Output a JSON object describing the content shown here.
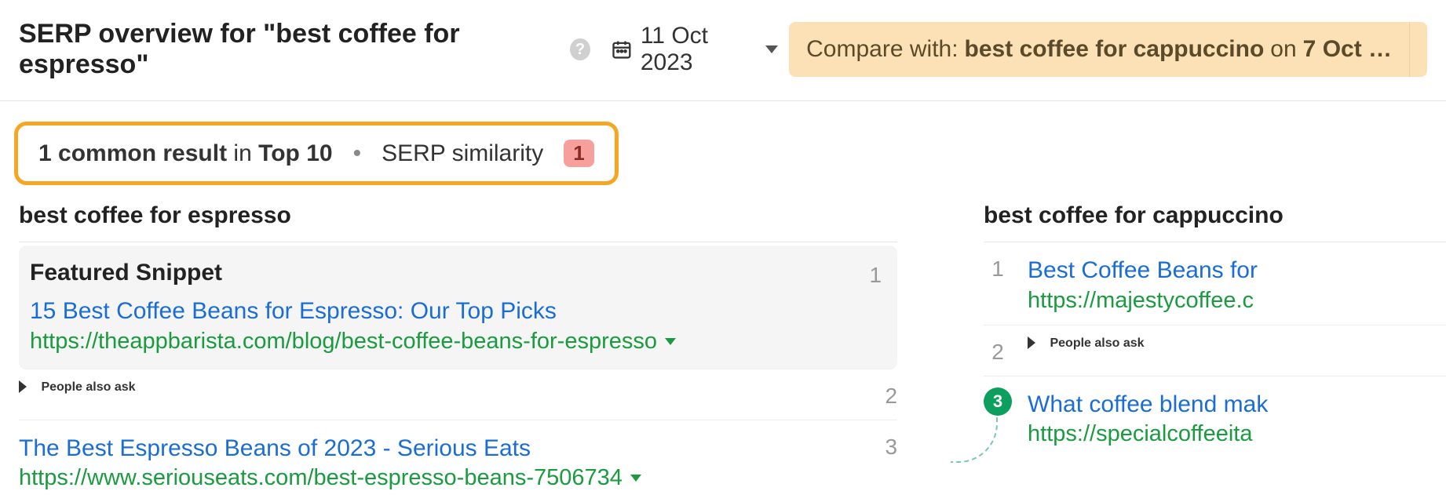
{
  "header": {
    "title_prefix": "SERP overview for \"",
    "keyword": "best coffee for espresso",
    "title_suffix": "\"",
    "date": "11 Oct 2023",
    "compare_prefix": "Compare with:",
    "compare_keyword": "best coffee for cappuccino",
    "compare_on": "on",
    "compare_date": "7 Oct …"
  },
  "stats": {
    "common_count": "1 common result",
    "common_in": "in",
    "common_scope": "Top 10",
    "similarity_label": "SERP similarity",
    "similarity_value": "1"
  },
  "left": {
    "heading": "best coffee for espresso",
    "featured_label": "Featured Snippet",
    "featured_rank": "1",
    "featured_title": "15 Best Coffee Beans for Espresso: Our Top Picks",
    "featured_url": "https://theappbarista.com/blog/best-coffee-beans-for-espresso",
    "paa_label": "People also ask",
    "paa_rank": "2",
    "r3_title": "The Best Espresso Beans of 2023 - Serious Eats",
    "r3_url": "https://www.seriouseats.com/best-espresso-beans-7506734",
    "r3_rank": "3"
  },
  "right": {
    "heading": "best coffee for cappuccino",
    "r1_rank": "1",
    "r1_title": "Best Coffee Beans for",
    "r1_url": "https://majestycoffee.c",
    "paa_rank": "2",
    "paa_label": "People also ask",
    "r3_rank": "3",
    "r3_title": "What coffee blend mak",
    "r3_url": "https://specialcoffeeita"
  }
}
